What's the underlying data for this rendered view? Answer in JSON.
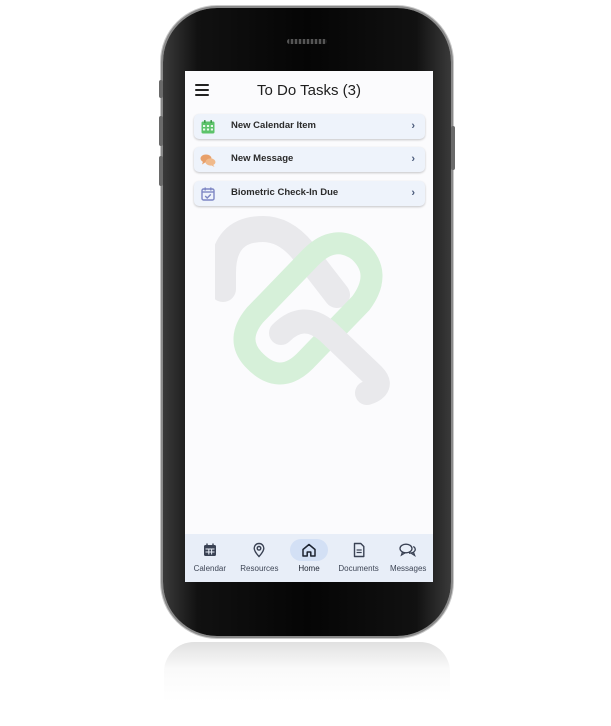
{
  "header": {
    "title": "To Do Tasks (3)",
    "menu_icon": "hamburger-menu-icon"
  },
  "tasks": [
    {
      "label": "New Calendar Item",
      "icon": "calendar-icon",
      "color": "#5cc36a"
    },
    {
      "label": "New Message",
      "icon": "chat-bubbles-icon",
      "color": "#e8a06a"
    },
    {
      "label": "Biometric Check-In Due",
      "icon": "calendar-check-icon",
      "color": "#7d86c4"
    }
  ],
  "nav": [
    {
      "label": "Calendar",
      "icon": "calendar-icon"
    },
    {
      "label": "Resources",
      "icon": "location-pin-icon"
    },
    {
      "label": "Home",
      "icon": "home-icon",
      "active": true
    },
    {
      "label": "Documents",
      "icon": "document-icon"
    },
    {
      "label": "Messages",
      "icon": "chat-bubbles-icon"
    }
  ],
  "colors": {
    "screen_background": "#fbfbfd",
    "task_background": "#eef3fb",
    "nav_background": "#e8eef8",
    "active_pill": "#d3e0f5",
    "watermark_green": "#d6f0d9",
    "watermark_gray": "#e9e9ec"
  }
}
